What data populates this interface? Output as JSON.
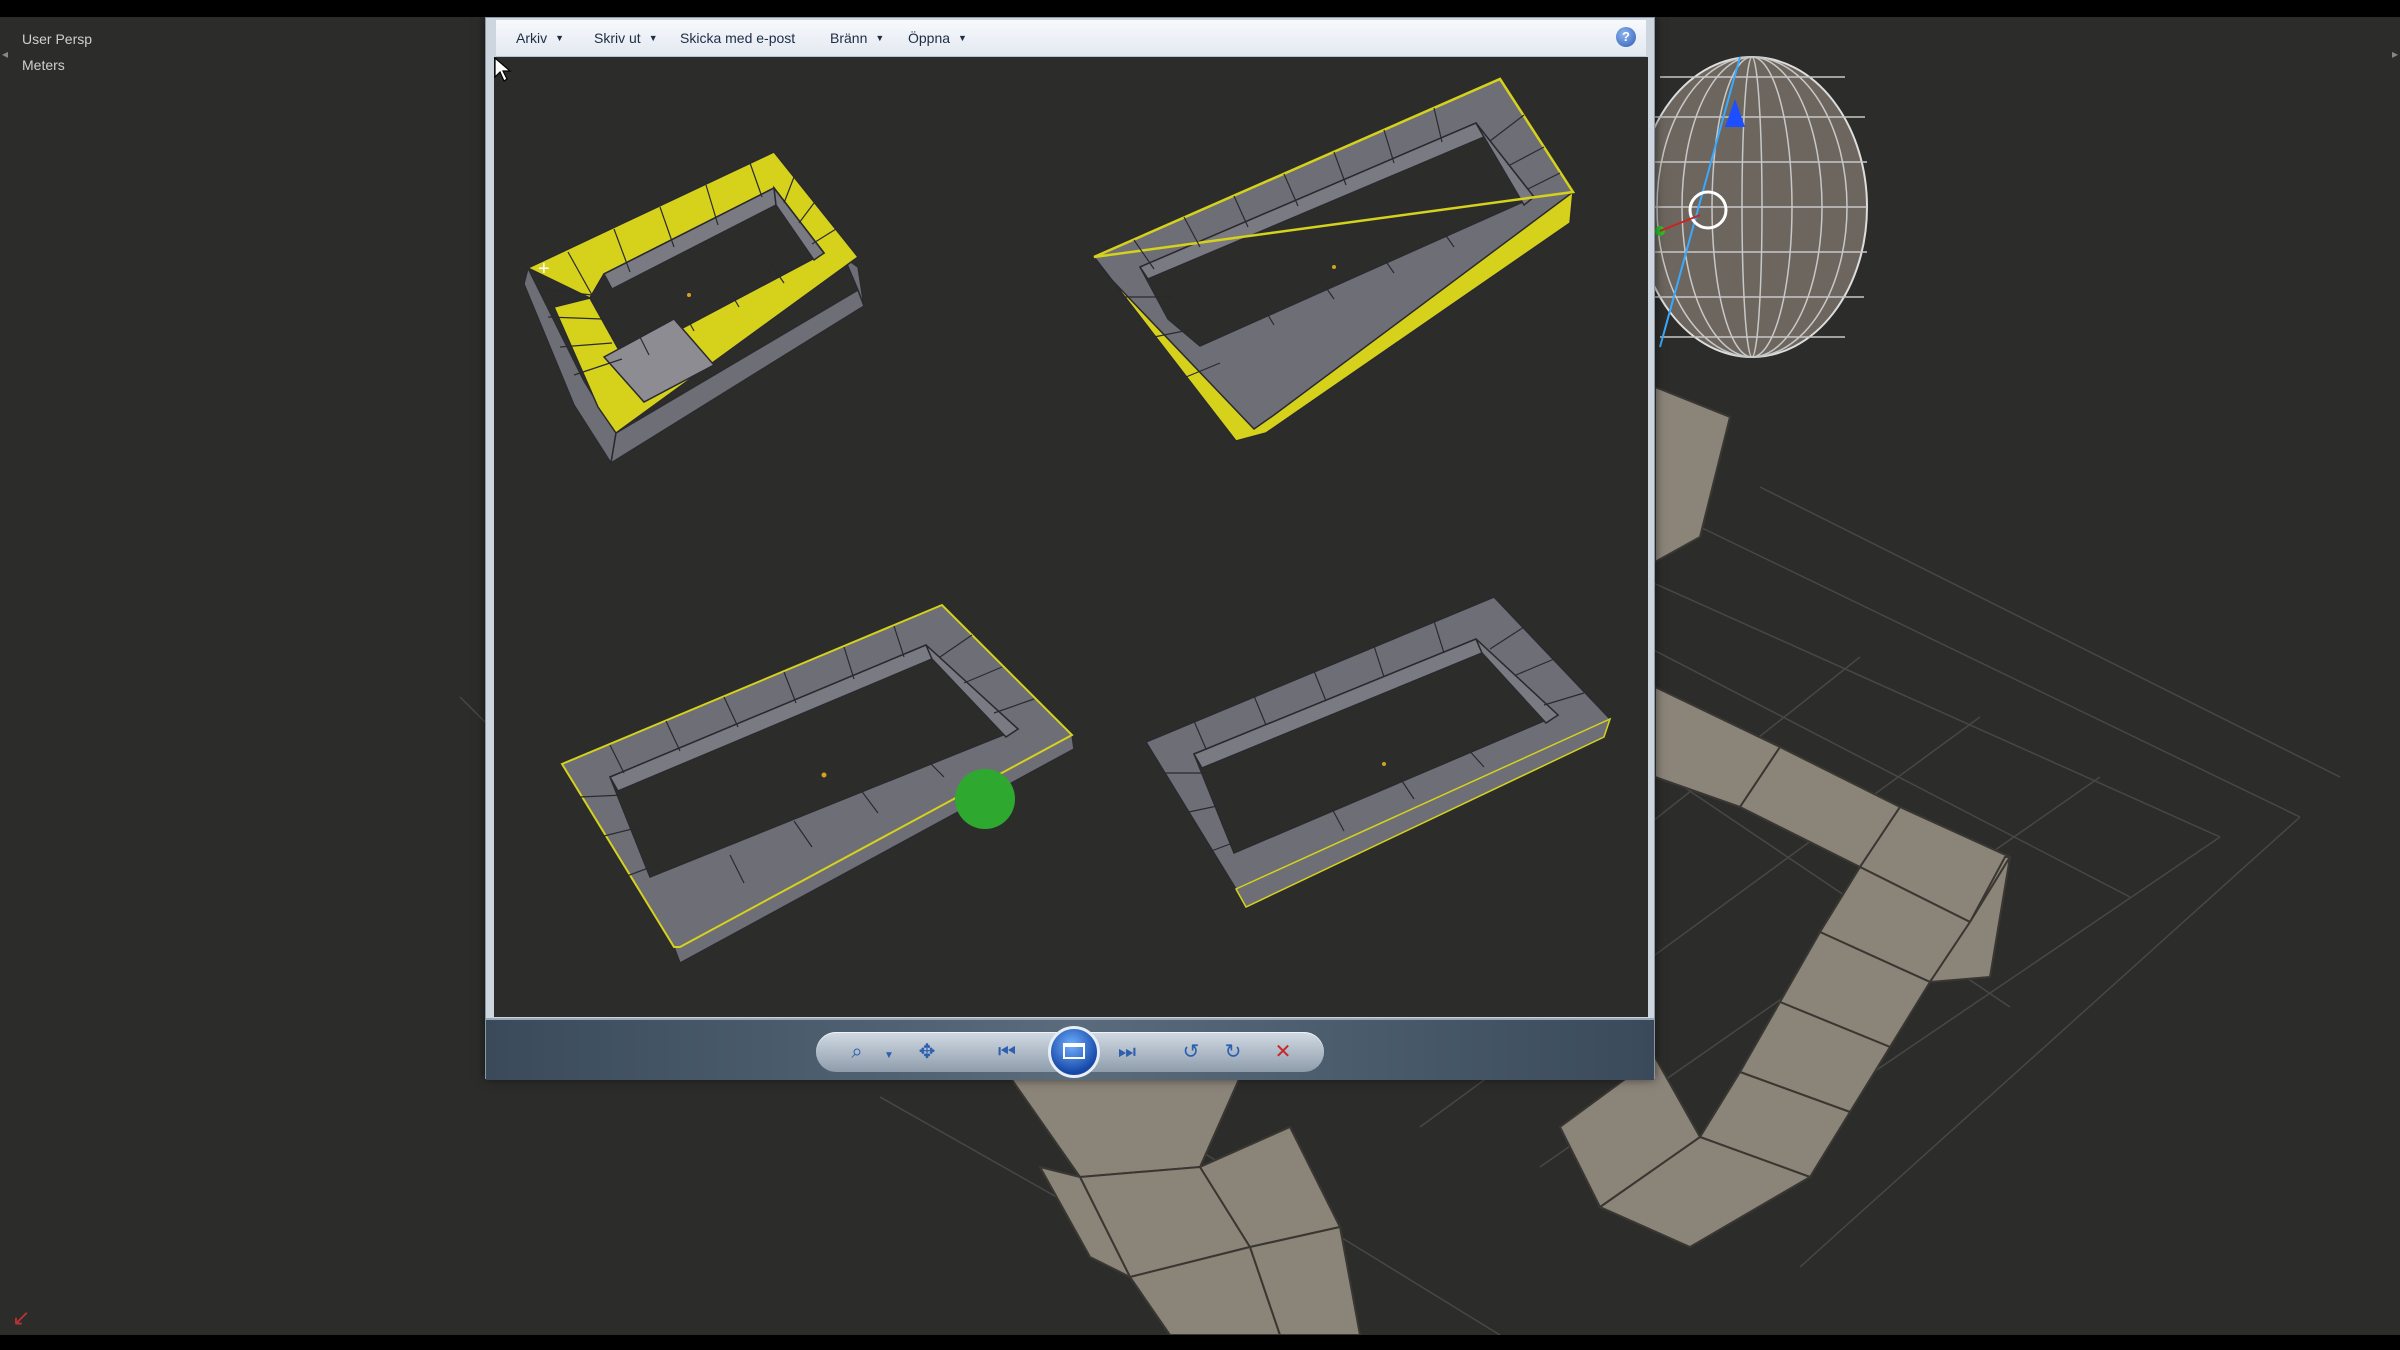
{
  "viewport": {
    "view_label": "User Persp",
    "units_label": "Meters",
    "colors": {
      "background": "#2c2d2b",
      "mesh": "#8c857b",
      "grid": "#4a4b48"
    }
  },
  "viewer": {
    "menu": [
      {
        "label": "Arkiv",
        "dropdown": true
      },
      {
        "label": "Skriv ut",
        "dropdown": true
      },
      {
        "label": "Skicka med e-post",
        "dropdown": false
      },
      {
        "label": "Bränn",
        "dropdown": true
      },
      {
        "label": "Öppna",
        "dropdown": true
      }
    ],
    "help_icon": "?",
    "colors": {
      "selection": "#d6d21c",
      "face": "#7a7a82",
      "edge": "#2a2a2e"
    },
    "toolbar": {
      "zoom_icon": "zoom-icon",
      "fit_icon": "actual-size-icon",
      "prev_icon": "previous-icon",
      "slideshow_icon": "slideshow-icon",
      "next_icon": "next-icon",
      "rotate_ccw_icon": "rotate-left-icon",
      "rotate_cw_icon": "rotate-right-icon",
      "delete_icon": "delete-icon"
    }
  }
}
